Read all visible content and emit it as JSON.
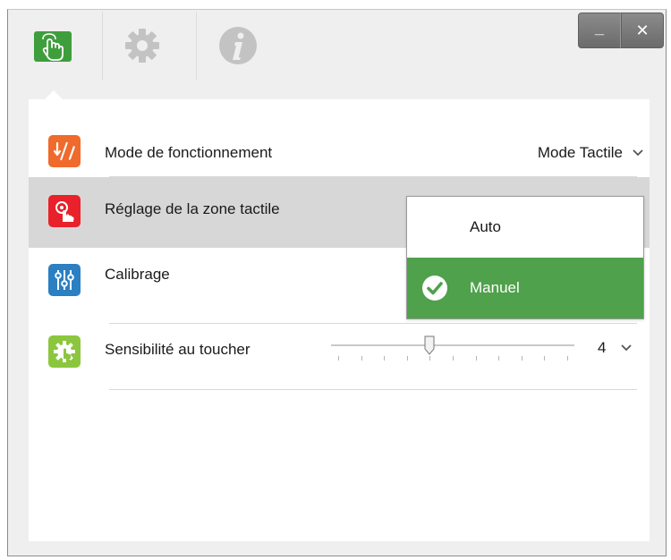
{
  "window": {
    "tabs": [
      {
        "icon": "touch-hand-icon",
        "active": true
      },
      {
        "icon": "gear-icon",
        "active": false
      },
      {
        "icon": "info-icon",
        "active": false
      }
    ],
    "minimize_label": "_",
    "close_label": "✕"
  },
  "settings": {
    "mode": {
      "label": "Mode de fonctionnement",
      "value": "Mode Tactile",
      "icon": "hand-pen-icon"
    },
    "zone": {
      "label": "Réglage de la zone tactile",
      "icon": "touch-zone-icon"
    },
    "calibration": {
      "label": "Calibrage",
      "icon": "sliders-icon"
    },
    "sensitivity": {
      "label": "Sensibilité au toucher",
      "value": "4",
      "level_fraction": 0.4,
      "icon": "gear-hand-icon"
    }
  },
  "dropdown": {
    "options": [
      {
        "label": "Auto",
        "selected": false
      },
      {
        "label": "Manuel",
        "selected": true
      }
    ]
  },
  "colors": {
    "active_tab": "#3f9e3c",
    "mode_icon": "#ef6a2c",
    "zone_icon": "#e8212a",
    "calib_icon": "#2b7fc3",
    "sens_icon": "#8cc63e",
    "selected_option": "#4fa14b"
  }
}
